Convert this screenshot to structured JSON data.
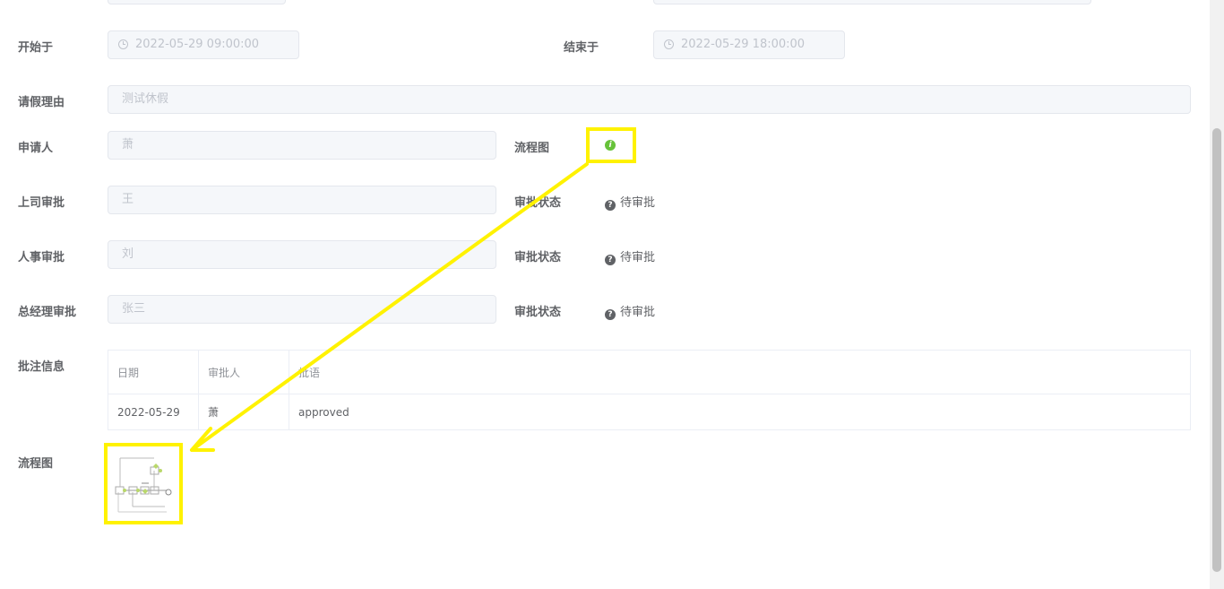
{
  "form": {
    "start_label": "开始于",
    "start_value": "2022-05-29 09:00:00",
    "end_label": "结束于",
    "end_value": "2022-05-29 18:00:00",
    "reason_label": "请假理由",
    "reason_value": "测试休假",
    "applicant_label": "申请人",
    "applicant_value": "萧",
    "flow_label": "流程图",
    "boss_label": "上司审批",
    "boss_value": "王",
    "boss_status_label": "审批状态",
    "boss_status": "待审批",
    "hr_label": "人事审批",
    "hr_value": "刘",
    "hr_status_label": "审批状态",
    "hr_status": "待审批",
    "gm_label": "总经理审批",
    "gm_value": "张三",
    "gm_status_label": "审批状态",
    "gm_status": "待审批",
    "comments_label": "批注信息",
    "flowchart_label": "流程图"
  },
  "comments_table": {
    "headers": [
      "日期",
      "审批人",
      "批语"
    ],
    "rows": [
      [
        "2022-05-29",
        "萧",
        "approved"
      ]
    ]
  },
  "icons": {
    "date": "clock-icon",
    "info": "info-icon",
    "status": "question-icon"
  },
  "colors": {
    "highlight": "#fff200",
    "info_green": "#67c23a"
  }
}
